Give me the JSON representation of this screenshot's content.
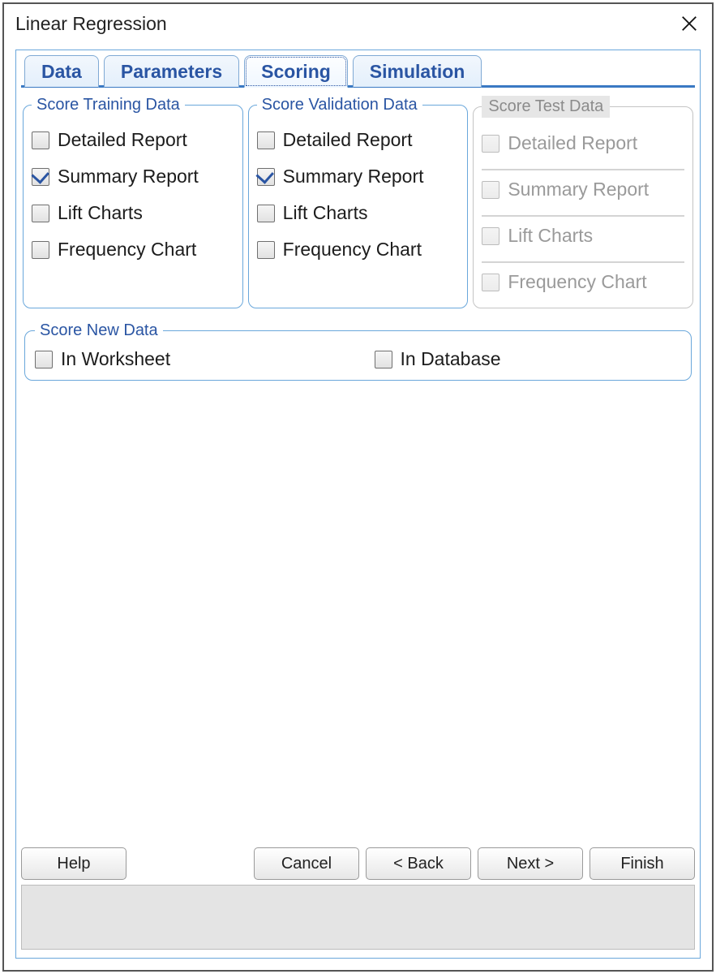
{
  "window": {
    "title": "Linear Regression"
  },
  "tabs": {
    "data": "Data",
    "parameters": "Parameters",
    "scoring": "Scoring",
    "simulation": "Simulation",
    "active": "scoring"
  },
  "training": {
    "legend": "Score Training Data",
    "detailed": "Detailed Report",
    "summary": "Summary Report",
    "lift": "Lift Charts",
    "freq": "Frequency Chart",
    "checked": {
      "detailed": false,
      "summary": true,
      "lift": false,
      "freq": false
    }
  },
  "validation": {
    "legend": "Score Validation Data",
    "detailed": "Detailed Report",
    "summary": "Summary Report",
    "lift": "Lift Charts",
    "freq": "Frequency Chart",
    "checked": {
      "detailed": false,
      "summary": true,
      "lift": false,
      "freq": false
    }
  },
  "test": {
    "legend": "Score Test Data",
    "detailed": "Detailed Report",
    "summary": "Summary Report",
    "lift": "Lift Charts",
    "freq": "Frequency Chart",
    "enabled": false
  },
  "newdata": {
    "legend": "Score New Data",
    "worksheet": "In Worksheet",
    "database": "In Database",
    "checked": {
      "worksheet": false,
      "database": false
    }
  },
  "buttons": {
    "help": "Help",
    "cancel": "Cancel",
    "back": "< Back",
    "next": "Next >",
    "finish": "Finish"
  }
}
